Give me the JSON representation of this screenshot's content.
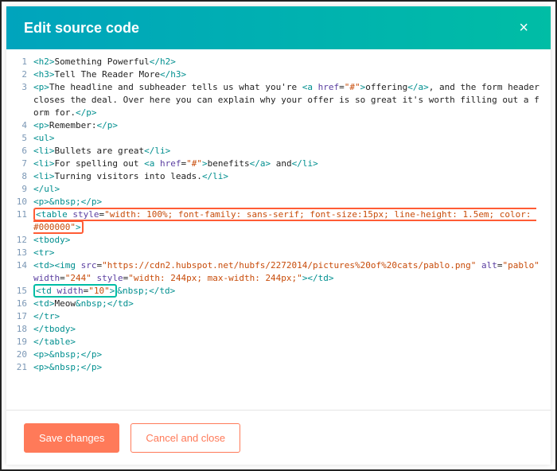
{
  "header": {
    "title": "Edit source code",
    "close_label": "×"
  },
  "footer": {
    "save_label": "Save changes",
    "cancel_label": "Cancel and close"
  },
  "code_text": {
    "t1_something_powerful": "Something Powerful",
    "t2_tell_reader_more": "Tell The Reader More",
    "t3_a": "The headline and subheader tells us what you're ",
    "t3_offering": "offering",
    "t3_b": ", and the form header closes the deal. Over here you can explain why your offer is so great it's worth filling out a form for.",
    "t4_remember": "Remember:",
    "t6_bullets": "Bullets are great",
    "t7_a": "For spelling out ",
    "t7_benefits": "benefits",
    "t7_b": " and",
    "t8_leads": "Turning visitors into leads.",
    "t14_alt": "pablo",
    "t14_width": "244",
    "t15_td_width": "10",
    "t16_meow": "Meow",
    "href_hash": "#",
    "img_src": "https://cdn2.hubspot.net/hubfs/2272014/pictures%20of%20cats/pablo.png",
    "table_style": "width: 100%; font-family: sans-serif; font-size:15px; line-height: 1.5em; color: #000000",
    "img_style": "width: 244px; max-width: 244px;"
  },
  "line_numbers": {
    "l1": "1",
    "l2": "2",
    "l3": "3",
    "l4": "4",
    "l5": "5",
    "l6": "6",
    "l7": "7",
    "l8": "8",
    "l9": "9",
    "l10": "10",
    "l11": "11",
    "l12": "12",
    "l13": "13",
    "l14": "14",
    "l15": "15",
    "l16": "16",
    "l17": "17",
    "l18": "18",
    "l19": "19",
    "l20": "20",
    "l21": "21"
  }
}
